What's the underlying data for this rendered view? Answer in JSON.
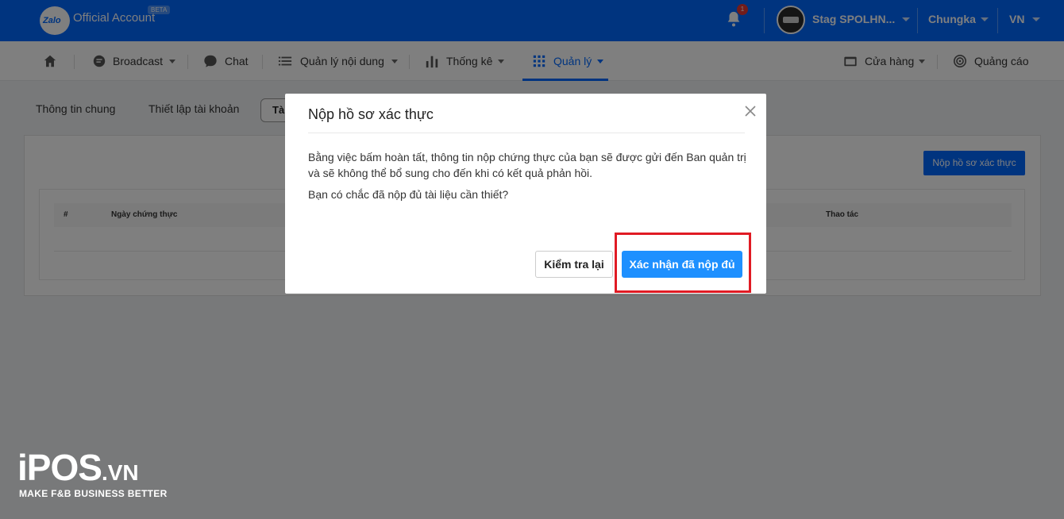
{
  "topbar": {
    "brand": "Zalo",
    "app_name": "Official Account",
    "beta": "BETA",
    "notification_count": "1",
    "account_name": "Stag SPOLHN...",
    "user_name": "Chungka",
    "language": "VN"
  },
  "nav": {
    "items": [
      "Broadcast",
      "Chat",
      "Quản lý nội dung",
      "Thống kê",
      "Quản lý"
    ],
    "right_items": [
      "Cửa hàng",
      "Quảng cáo"
    ],
    "active": "Quản lý"
  },
  "subtabs": [
    "Thông tin chung",
    "Thiết lập tài khoản",
    "Tà"
  ],
  "card": {
    "submit_button": "Nộp hồ sơ xác thực",
    "columns": [
      "#",
      "Ngày chứng thực",
      "Thao tác"
    ]
  },
  "modal": {
    "title": "Nộp hồ sơ xác thực",
    "body": "Bằng việc bấm hoàn tất, thông tin nộp chứng thực của bạn sẽ được gửi đến Ban quản trị và sẽ không thể bổ sung cho đến khi có kết quả phản hồi.",
    "question": "Bạn có chắc đã nộp đủ tài liệu cần thiết?",
    "cancel_label": "Kiểm tra lại",
    "confirm_label": "Xác nhận đã nộp đủ"
  },
  "watermark": {
    "logo": "iPOS",
    "logo_suffix": ".VN",
    "tagline": "MAKE F&B BUSINESS BETTER"
  },
  "colors": {
    "brand": "#0068ff",
    "confirm": "#1e90ff",
    "highlight": "#e01b24"
  }
}
